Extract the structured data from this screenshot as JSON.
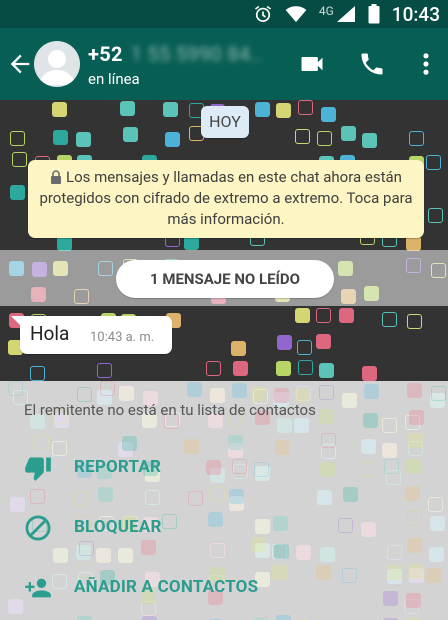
{
  "status_bar": {
    "network": "4G",
    "time": "10:43"
  },
  "header": {
    "contact_prefix": "+52",
    "contact_rest": "1 55 5990 84..",
    "status": "en línea"
  },
  "chat": {
    "date_chip": "HOY",
    "encryption_notice": "Los mensajes y llamadas en este chat ahora están protegidos con cifrado de extremo a extremo. Toca para más información.",
    "unread_label": "1 MENSAJE NO LEÍDO",
    "messages": [
      {
        "text": "Hola",
        "time": "10:43 a. m."
      }
    ]
  },
  "sheet": {
    "title": "El remitente no está en tu lista de contactos",
    "actions": [
      {
        "label": "REPORTAR",
        "icon": "thumbs-down-icon"
      },
      {
        "label": "BLOQUEAR",
        "icon": "block-icon"
      },
      {
        "label": "AÑADIR A CONTACTOS",
        "icon": "add-contact-icon"
      }
    ]
  },
  "colors": {
    "header": "#075e54",
    "status_bar": "#054d44",
    "accent": "#2a9d8f",
    "notice_bg": "#fdf5c3",
    "chat_bg": "#333333"
  }
}
